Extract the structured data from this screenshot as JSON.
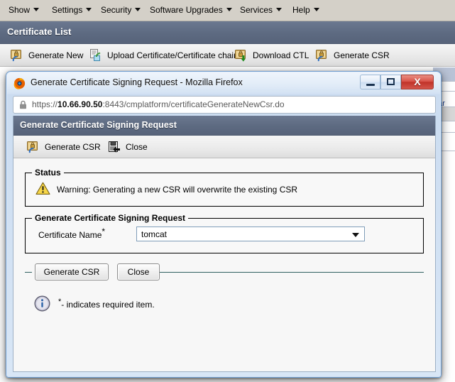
{
  "background": {
    "menubar": {
      "items": [
        {
          "label": "Show",
          "has_caret": true
        },
        {
          "label": "Settings",
          "has_caret": true
        },
        {
          "label": "Security",
          "has_caret": true
        },
        {
          "label": "Software Upgrades",
          "has_caret": true
        },
        {
          "label": "Services",
          "has_caret": true
        },
        {
          "label": "Help",
          "has_caret": true
        }
      ]
    },
    "page_title": "Certificate List",
    "toolbar": [
      {
        "label": "Generate New",
        "icon": "certificate-refresh-icon"
      },
      {
        "label": "Upload Certificate/Certificate chain",
        "icon": "upload-certificate-icon"
      },
      {
        "label": "Download CTL",
        "icon": "certificate-download-icon"
      },
      {
        "label": "Generate CSR",
        "icon": "certificate-refresh-icon"
      }
    ],
    "clipped_link": "ear"
  },
  "dialog": {
    "window_title": "Generate Certificate Signing Request - Mozilla Firefox",
    "browser_icon": "firefox-logo-icon",
    "window_controls": {
      "minimize": "minimize-button",
      "maximize": "maximize-button",
      "close": "close-button",
      "close_glyph": "X"
    },
    "url": {
      "scheme": "https://",
      "host": "10.66.90.50",
      "rest": ":8443/cmplatform/certificateGenerateNewCsr.do",
      "lock_icon": "lock-icon"
    },
    "header_title": "Generate Certificate Signing Request",
    "toolbar": [
      {
        "label": "Generate CSR",
        "icon": "certificate-refresh-icon"
      },
      {
        "label": "Close",
        "icon": "close-document-icon"
      }
    ],
    "status": {
      "legend": "Status",
      "icon": "warning-triangle-icon",
      "message": "Warning: Generating a new CSR will overwrite the existing CSR"
    },
    "form": {
      "legend": "Generate Certificate Signing Request",
      "field_label": "Certificate Name",
      "required_marker": "*",
      "select_value": "tomcat",
      "select_options": [
        "tomcat"
      ]
    },
    "buttons": {
      "generate": "Generate CSR",
      "close": "Close"
    },
    "footer": {
      "icon": "info-circle-icon",
      "marker": "*",
      "text": "- indicates required item."
    }
  },
  "colors": {
    "menubar_bg": "#d4d0c8",
    "header_bar": "#5d6a81",
    "toolbar_bg": "#ebebeb",
    "dialog_border": "#6f9ed1",
    "close_button": "#c03329",
    "warning_yellow": "#f7d648",
    "link_blue": "#1a3f8f"
  }
}
